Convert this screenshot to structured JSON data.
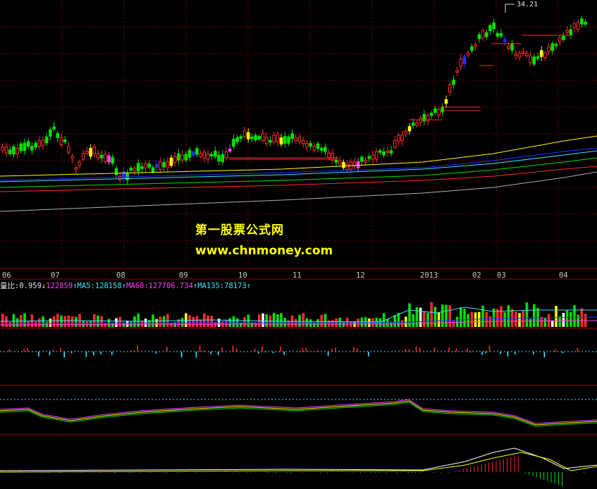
{
  "watermark": {
    "line1": "第一股票公式网",
    "line2": "www.chnmoney.com"
  },
  "price_high_label": "34.21",
  "volume_stats": {
    "ratio_label": "量比:0.959",
    "ratio_arrow": "↓",
    "volume": "122859",
    "volume_arrow": "↑",
    "ma5": "MA5:128158",
    "ma5_arrow": "↑",
    "ma60": "MA60:127706.734",
    "ma60_arrow": "↑",
    "ma135": "MA135:78173",
    "ma135_arrow": "↑"
  },
  "colors": {
    "background": "#000000",
    "grid": "#7a0000",
    "up": "#ff2a2a",
    "down": "#00e000",
    "yellow": "#ffff00",
    "cyan": "#40e0ff",
    "magenta": "#ff40ff",
    "blue": "#2030ff",
    "white": "#ffffff",
    "gray": "#b0b0b0",
    "label": "#c8c8c8"
  },
  "chart_data": {
    "type": "candlestick",
    "x_tick_labels": [
      "06",
      "07",
      "08",
      "09",
      "10",
      "11",
      "12",
      "2013",
      "02",
      "03",
      "04"
    ],
    "price_high": 34.21,
    "panels": [
      "price",
      "volume",
      "histogram",
      "oscillator",
      "macd"
    ]
  }
}
